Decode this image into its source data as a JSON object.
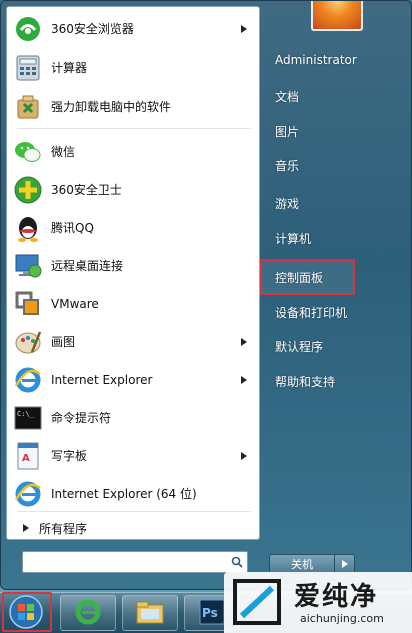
{
  "programs": [
    {
      "label": "360安全浏览器",
      "icon": "360-browser-icon",
      "submenu": true
    },
    {
      "label": "计算器",
      "icon": "calculator-icon",
      "submenu": false
    },
    {
      "label": "强力卸载电脑中的软件",
      "icon": "uninstaller-icon",
      "submenu": false
    },
    {
      "label": "微信",
      "icon": "wechat-icon",
      "submenu": false
    },
    {
      "label": "360安全卫士",
      "icon": "360-safeguard-icon",
      "submenu": false
    },
    {
      "label": "腾讯QQ",
      "icon": "qq-icon",
      "submenu": false
    },
    {
      "label": "远程桌面连接",
      "icon": "remote-desktop-icon",
      "submenu": false
    },
    {
      "label": "VMware",
      "icon": "vmware-icon",
      "submenu": false
    },
    {
      "label": "画图",
      "icon": "paint-icon",
      "submenu": true
    },
    {
      "label": "Internet Explorer",
      "icon": "ie-icon",
      "submenu": true
    },
    {
      "label": "命令提示符",
      "icon": "cmd-icon",
      "submenu": false
    },
    {
      "label": "写字板",
      "icon": "wordpad-icon",
      "submenu": true
    },
    {
      "label": "Internet Explorer (64 位)",
      "icon": "ie-icon",
      "submenu": false
    }
  ],
  "all_programs": "所有程序",
  "search": {
    "placeholder": ""
  },
  "right_menu": [
    {
      "label": "Administrator"
    },
    {
      "label": "文档"
    },
    {
      "label": "图片"
    },
    {
      "label": "音乐"
    },
    {
      "label": "游戏"
    },
    {
      "label": "计算机"
    },
    {
      "label": "控制面板"
    },
    {
      "label": "设备和打印机"
    },
    {
      "label": "默认程序"
    },
    {
      "label": "帮助和支持"
    }
  ],
  "shutdown_label": "关机",
  "watermark": {
    "title": "爱纯净",
    "url": "aichunjing.com"
  },
  "colors": {
    "highlight": "#d9343b",
    "menu_blue": "#2d5f7a"
  }
}
